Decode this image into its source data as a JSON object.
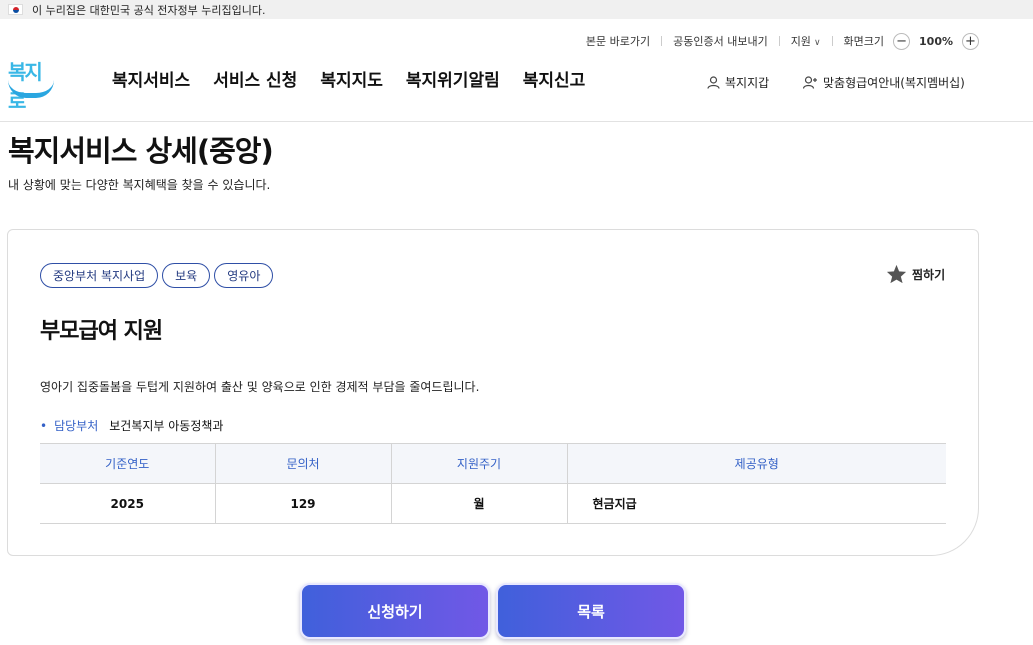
{
  "gov_banner": {
    "text": "이 누리집은 대한민국 공식 전자정부 누리집입니다."
  },
  "utility": {
    "skip_link": "본문 바로가기",
    "cert_export": "공동인증서 내보내기",
    "support": "지원",
    "zoom_label": "화면크기",
    "zoom_value": "100%"
  },
  "logo": {
    "text": "복지로"
  },
  "gnb": [
    {
      "label": "복지서비스"
    },
    {
      "label": "서비스 신청"
    },
    {
      "label": "복지지도"
    },
    {
      "label": "복지위기알림"
    },
    {
      "label": "복지신고"
    }
  ],
  "member": {
    "wallet": "복지지갑",
    "membership": "맞춤형급여안내(복지멤버십)"
  },
  "page": {
    "title": "복지서비스 상세(중앙)",
    "description": "내 상황에 맞는 다양한 복지혜택을 찾을 수 있습니다."
  },
  "service": {
    "tags": [
      "중앙부처 복지사업",
      "보육",
      "영유아"
    ],
    "favorite_label": "찜하기",
    "title": "부모급여 지원",
    "description": "영아기 집중돌봄을 두텁게 지원하여 출산 및 양육으로 인한 경제적 부담을 줄여드립니다.",
    "dept_label": "담당부처",
    "dept_value": "보건복지부 아동정책과",
    "table": {
      "headers": [
        "기준연도",
        "문의처",
        "지원주기",
        "제공유형"
      ],
      "row": [
        "2025",
        "129",
        "월",
        "현금지급"
      ]
    }
  },
  "actions": {
    "apply": "신청하기",
    "list": "목록"
  },
  "colors": {
    "accent": "#3461c7",
    "button_start": "#4060db",
    "button_end": "#7158e6",
    "logo": "#39b7e6"
  }
}
